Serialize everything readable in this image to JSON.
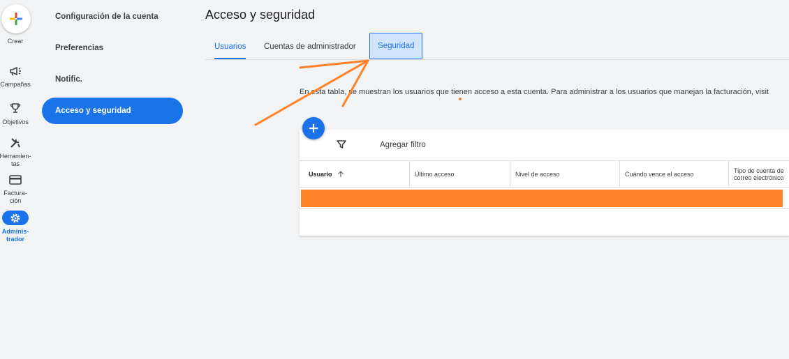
{
  "rail": {
    "create_label": "Crear",
    "items": [
      {
        "label": "Campañas",
        "icon": "megaphone-icon"
      },
      {
        "label": "Objetivos",
        "icon": "trophy-icon"
      },
      {
        "label": "Herramien-tas",
        "icon": "tools-icon"
      },
      {
        "label": "Factura-ción",
        "icon": "credit-card-icon"
      },
      {
        "label": "Adminis-trador",
        "icon": "gear-icon",
        "active": true
      }
    ]
  },
  "subnav": {
    "items": [
      {
        "label": "Configuración de la cuenta"
      },
      {
        "label": "Preferencias"
      },
      {
        "label": "Notific."
      },
      {
        "label": "Acceso y seguridad",
        "active": true
      }
    ]
  },
  "page": {
    "title": "Acceso y seguridad",
    "tabs": [
      {
        "label": "Usuarios",
        "active": true
      },
      {
        "label": "Cuentas de administrador"
      },
      {
        "label": "Seguridad",
        "highlighted": true
      }
    ],
    "description": "En esta tabla, se muestran los usuarios que tienen acceso a esta cuenta. Para administrar a los usuarios que manejan la facturación, visit",
    "filter_label": "Agregar filtro",
    "table": {
      "columns": [
        "Usuario",
        "Último acceso",
        "Nivel de acceso",
        "Cuándo vence el acceso",
        "Tipo de cuenta de correo electrónico"
      ],
      "sort_icon": "arrow-up-icon"
    }
  },
  "colors": {
    "accent": "#1a73e8",
    "annotation": "#ff8228",
    "background": "#f1f3f4"
  }
}
